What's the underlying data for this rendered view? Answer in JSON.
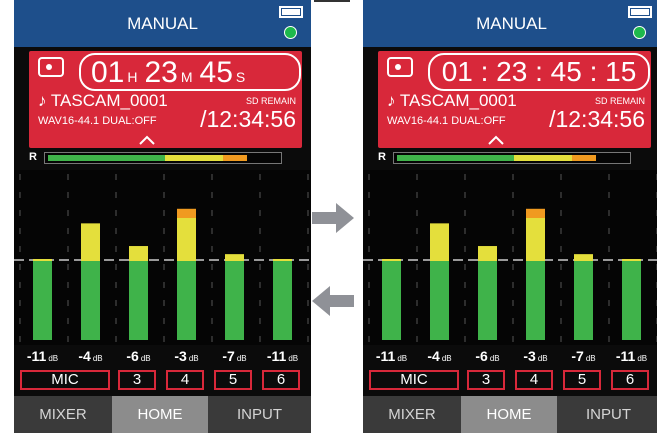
{
  "colors": {
    "title_bar": "#1e4f8b",
    "record_panel": "#d8283a",
    "meter_green": "#3fb34a",
    "meter_yellow": "#e4df3c",
    "meter_orange": "#f09a20",
    "status_led": "#1db84c",
    "arrow": "#8f9197"
  },
  "icons": {
    "battery": "battery-full-icon",
    "status": "green-led-icon",
    "record": "record-icon",
    "expand": "chevron-up-icon",
    "next": "arrow-right-icon",
    "back": "arrow-left-icon"
  },
  "screens": [
    {
      "title": "MANUAL",
      "time_display": "hms",
      "time": {
        "hours": "01",
        "h_unit": "H",
        "minutes": "23",
        "m_unit": "M",
        "seconds": "45",
        "s_unit": "S"
      },
      "time_text": "",
      "file_name": "♪ TASCAM_0001",
      "sd_remain_label": "SD REMAIN",
      "format_info": "WAV16-44.1 DUAL:OFF",
      "remain_time": "/12:34:56",
      "meter_label": "R",
      "channels": [
        {
          "db": "-11",
          "unit": "dB",
          "label": "MIC",
          "level_fraction": 0.5
        },
        {
          "db": "-4",
          "unit": "dB",
          "label": "3",
          "level_fraction": 0.72
        },
        {
          "db": "-6",
          "unit": "dB",
          "label": "4",
          "level_fraction": 0.58
        },
        {
          "db": "-3",
          "unit": "dB",
          "label": "5",
          "level_fraction": 0.81
        },
        {
          "db": "-7",
          "unit": "dB",
          "label": "6",
          "level_fraction": 0.53
        },
        {
          "db": "-11",
          "unit": "dB",
          "label": "",
          "level_fraction": 0.5
        }
      ],
      "tabs": [
        "MIXER",
        "HOME",
        "INPUT"
      ],
      "active_tab": "HOME"
    },
    {
      "title": "MANUAL",
      "time_display": "colon",
      "time": {
        "hours": "",
        "h_unit": "",
        "minutes": "",
        "m_unit": "",
        "seconds": "",
        "s_unit": ""
      },
      "time_text": "01 : 23 : 45 : 15",
      "file_name": "♪ TASCAM_0001",
      "sd_remain_label": "SD REMAIN",
      "format_info": "WAV16-44.1 DUAL:OFF",
      "remain_time": "/12:34:56",
      "meter_label": "R",
      "channels": [
        {
          "db": "-11",
          "unit": "dB",
          "label": "MIC",
          "level_fraction": 0.5
        },
        {
          "db": "-4",
          "unit": "dB",
          "label": "3",
          "level_fraction": 0.72
        },
        {
          "db": "-6",
          "unit": "dB",
          "label": "4",
          "level_fraction": 0.58
        },
        {
          "db": "-3",
          "unit": "dB",
          "label": "5",
          "level_fraction": 0.81
        },
        {
          "db": "-7",
          "unit": "dB",
          "label": "6",
          "level_fraction": 0.53
        },
        {
          "db": "-11",
          "unit": "dB",
          "label": "",
          "level_fraction": 0.5
        }
      ],
      "tabs": [
        "MIXER",
        "HOME",
        "INPUT"
      ],
      "active_tab": "HOME"
    }
  ]
}
